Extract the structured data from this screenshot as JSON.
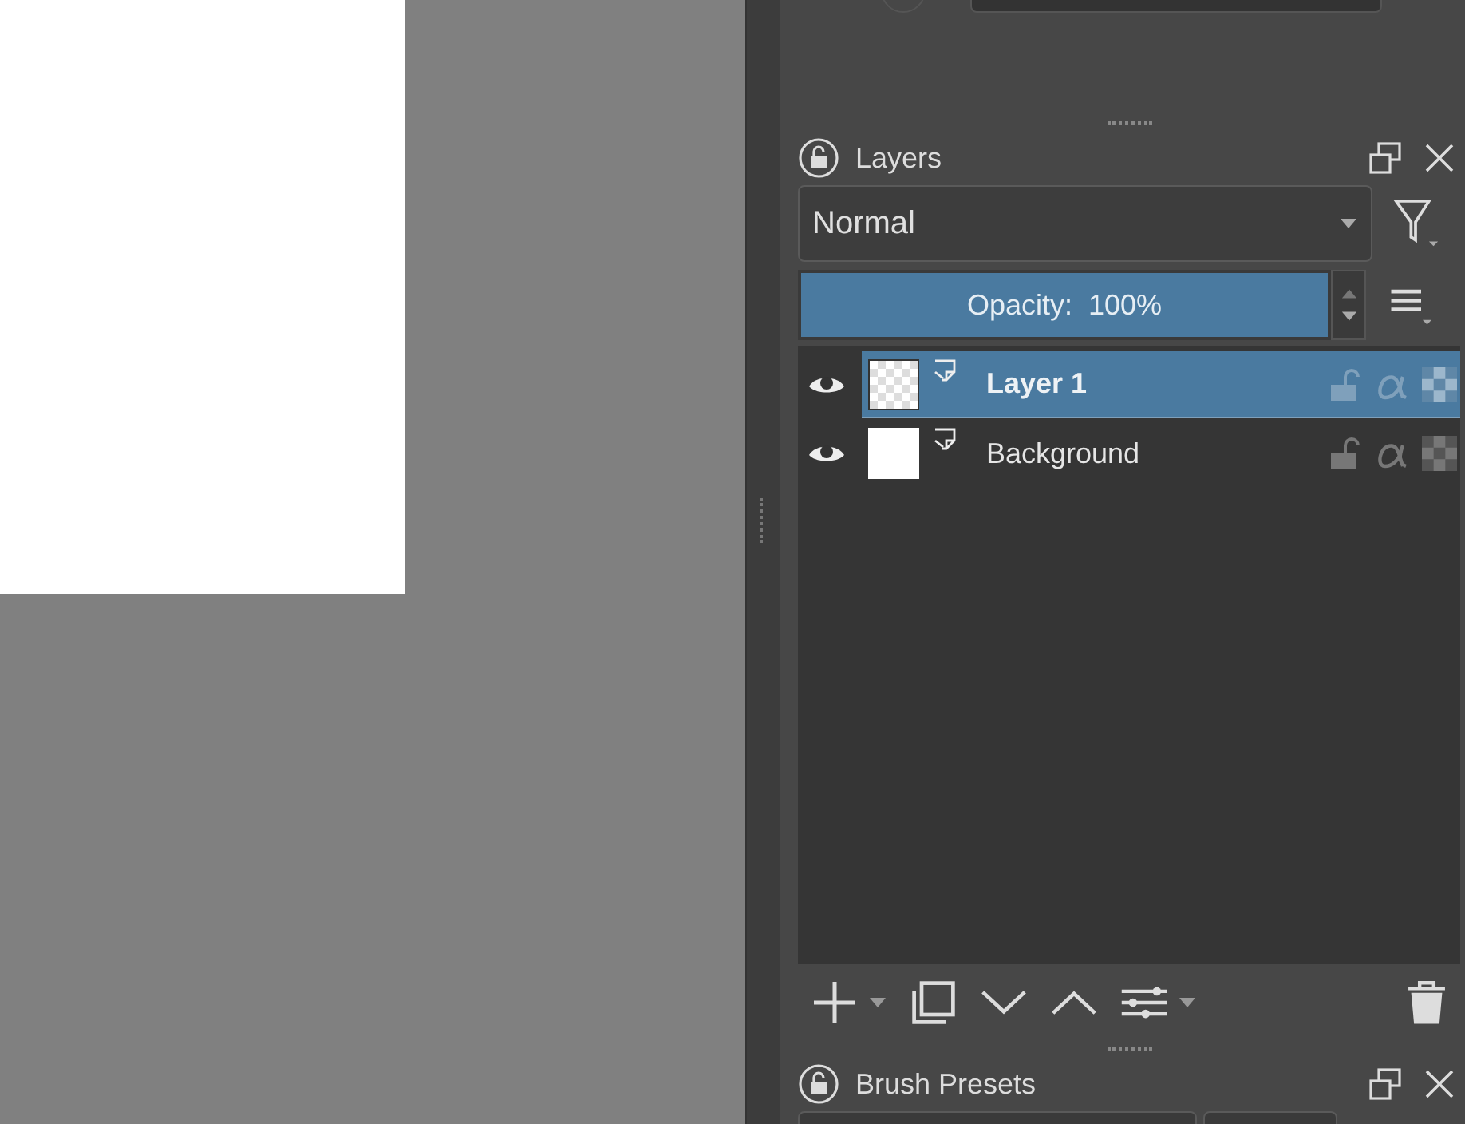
{
  "layers_panel": {
    "title": "Layers",
    "blend_mode": "Normal",
    "opacity": {
      "label": "Opacity:  100%",
      "level": 1
    },
    "layers": [
      {
        "name": "Layer 1",
        "selected": true,
        "visible": true,
        "kind": "transparent"
      },
      {
        "name": "Background",
        "selected": false,
        "visible": true,
        "kind": "filled"
      }
    ]
  },
  "brush_presets_panel": {
    "title": "Brush Presets"
  }
}
